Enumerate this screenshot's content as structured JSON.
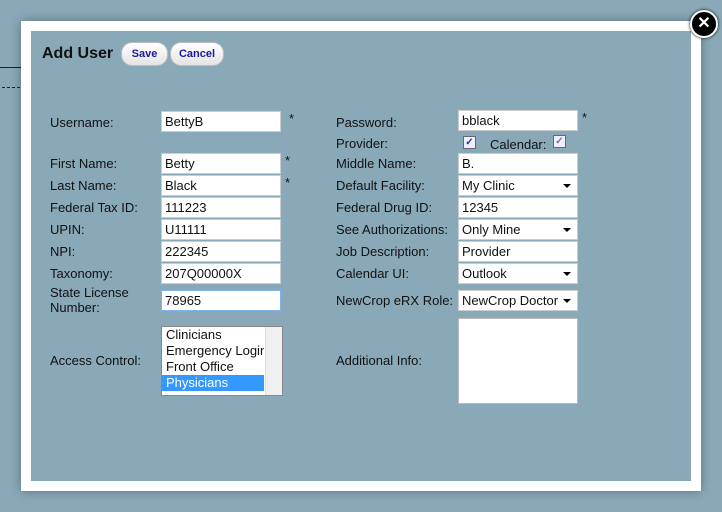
{
  "dialog": {
    "title": "Add User",
    "save": "Save",
    "cancel": "Cancel",
    "close_icon": "close-icon"
  },
  "left": [
    {
      "label": "Username:",
      "value": "BettyB",
      "required": "*"
    },
    {
      "label": "First Name:",
      "value": "Betty",
      "required": "*"
    },
    {
      "label": "Last Name:",
      "value": "Black",
      "required": "*"
    },
    {
      "label": "Federal Tax ID:",
      "value": "111223"
    },
    {
      "label": "UPIN:",
      "value": "U11111"
    },
    {
      "label": "NPI:",
      "value": "222345"
    },
    {
      "label": "Taxonomy:",
      "value": "207Q00000X"
    },
    {
      "label": "State License Number:",
      "value": "78965"
    }
  ],
  "access": {
    "label": "Access Control:",
    "options": [
      "Clinicians",
      "Emergency Login",
      "Front Office",
      "Physicians"
    ],
    "selected": "Physicians"
  },
  "right": {
    "password": {
      "label": "Password:",
      "value": "bblack",
      "required": "*"
    },
    "provider": {
      "label": "Provider:",
      "checked": true
    },
    "calendar": {
      "label": "Calendar:",
      "checked": true
    },
    "middle": {
      "label": "Middle Name:",
      "value": "B."
    },
    "facility": {
      "label": "Default Facility:",
      "value": "My Clinic"
    },
    "drug": {
      "label": "Federal Drug ID:",
      "value": "12345"
    },
    "auth": {
      "label": "See Authorizations:",
      "value": "Only Mine"
    },
    "job": {
      "label": "Job Description:",
      "value": "Provider"
    },
    "calui": {
      "label": "Calendar UI:",
      "value": "Outlook"
    },
    "erx": {
      "label": "NewCrop eRX Role:",
      "value": "NewCrop Doctor"
    },
    "info": {
      "label": "Additional Info:",
      "value": ""
    }
  }
}
